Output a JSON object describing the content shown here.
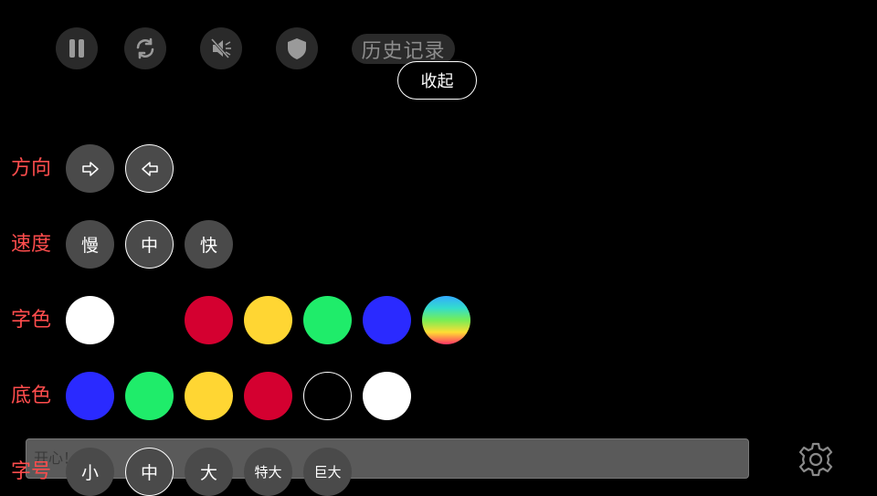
{
  "toolbar": {
    "pause_icon": "pause-icon",
    "refresh_icon": "refresh-icon",
    "mute_icon": "mute-icon",
    "shield_icon": "shield-icon",
    "history_label": "历史记录",
    "collapse_label": "收起"
  },
  "direction": {
    "label": "方向",
    "options": [
      "right-arrow-icon",
      "left-arrow-icon"
    ],
    "selected_index": 1
  },
  "speed": {
    "label": "速度",
    "options": [
      "慢",
      "中",
      "快"
    ],
    "selected_index": 1
  },
  "text_color": {
    "label": "字色",
    "swatches": [
      "#ffffff",
      "#000000",
      "#d40030",
      "#ffd633",
      "#1fec6a",
      "#2a2aff",
      "rainbow"
    ]
  },
  "background_color": {
    "label": "底色",
    "swatches": [
      "#2a2aff",
      "#1fec6a",
      "#ffd633",
      "#d40030",
      "#000000",
      "#ffffff"
    ],
    "selected_index": 4
  },
  "font_size": {
    "label": "字号",
    "options": [
      "小",
      "中",
      "大",
      "特大",
      "巨大"
    ],
    "selected_index": 1
  },
  "input": {
    "value": "开心！"
  },
  "settings_icon": "gear-icon",
  "colors": {
    "accent_label": "#ff4d4d",
    "button_bg": "#4a4a4a",
    "toolbar_bg": "#2a2a2a"
  }
}
